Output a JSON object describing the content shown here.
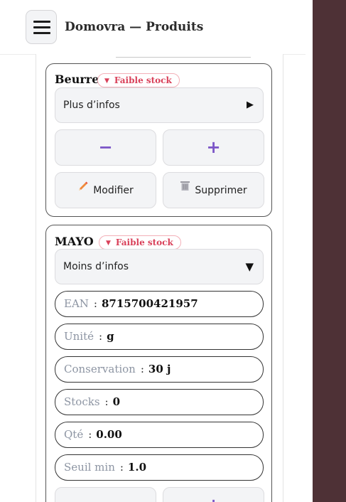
{
  "header": {
    "title": "Domovra — Produits",
    "menu_icon": "hamburger-icon"
  },
  "products": [
    {
      "name": "Beurre",
      "badge": "Faible stock",
      "toggle_label": "Plus d’infos",
      "toggle_arrow": "▶",
      "minus": "−",
      "plus": "+",
      "edit_label": "Modifier",
      "delete_label": "Supprimer"
    },
    {
      "name": "MAYO",
      "badge": "Faible stock",
      "toggle_label": "Moins d’infos",
      "toggle_arrow": "▼",
      "fields": [
        {
          "key": "EAN",
          "value": "8715700421957"
        },
        {
          "key": "Unité",
          "value": "g"
        },
        {
          "key": "Conservation",
          "value": "30 j"
        },
        {
          "key": "Stocks",
          "value": "0"
        },
        {
          "key": "Qté",
          "value": "0.00"
        },
        {
          "key": "Seuil min",
          "value": "1.0"
        }
      ],
      "minus": "−",
      "plus": "+"
    }
  ],
  "badge_marker": "▼",
  "colors": {
    "background": "#4e3136",
    "accent": "#7b55c7",
    "badge": "#d9415a"
  }
}
